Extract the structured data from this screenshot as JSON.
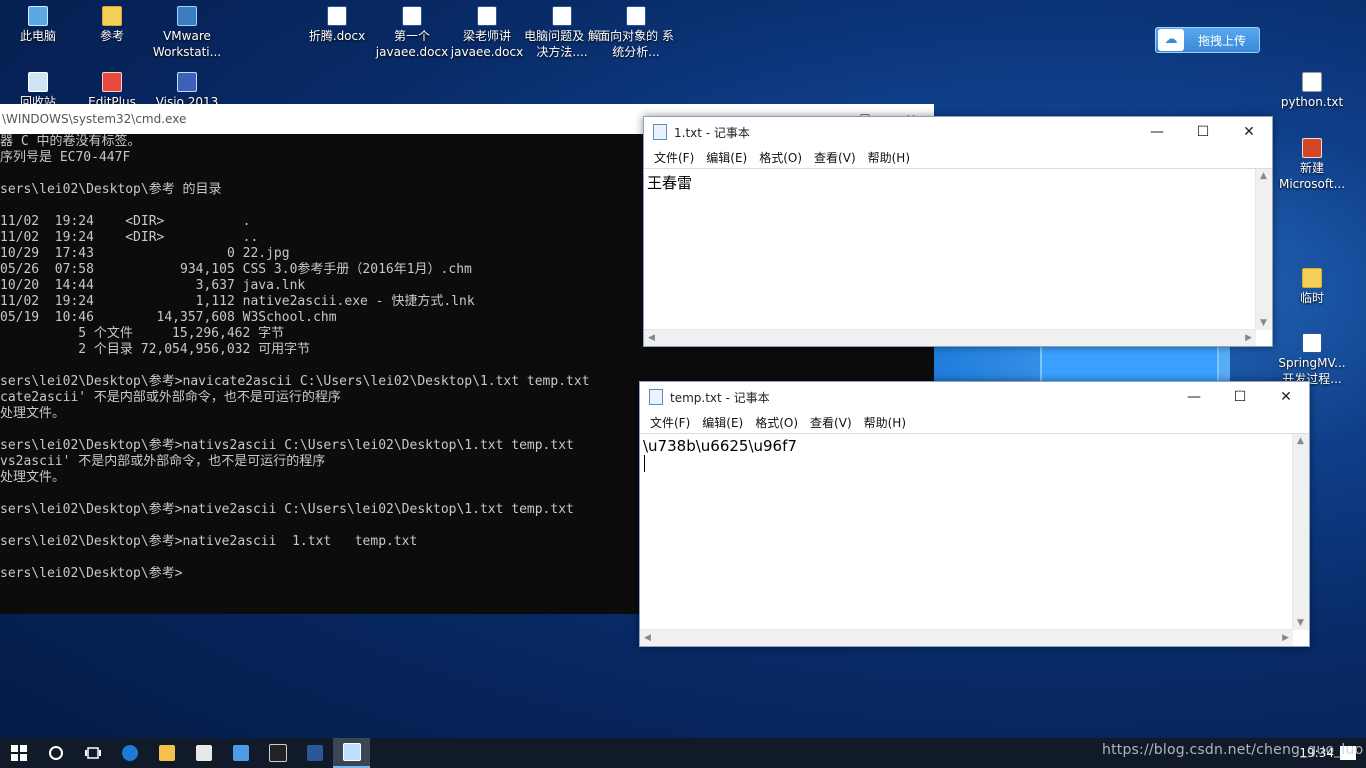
{
  "desktop": {
    "icons_top": [
      {
        "label": "此电脑",
        "icon": "pc-icon"
      },
      {
        "label": "参考",
        "icon": "folder-icon"
      },
      {
        "label": "VMware Workstati...",
        "icon": "vmware-icon"
      },
      {
        "label": "折腾.docx",
        "icon": "word-doc-icon"
      },
      {
        "label": "第一个 javaee.docx",
        "icon": "word-doc-icon"
      },
      {
        "label": "梁老师讲 javaee.docx",
        "icon": "word-doc-icon"
      },
      {
        "label": "电脑问题及 解决方法....",
        "icon": "word-doc-icon"
      },
      {
        "label": "面向对象的 系统分析...",
        "icon": "word-doc-icon"
      }
    ],
    "icons_row2": [
      {
        "label": "回收站",
        "icon": "recycle-bin-icon"
      },
      {
        "label": "EditPlus",
        "icon": "editplus-icon"
      },
      {
        "label": "Visio 2013",
        "icon": "visio-icon"
      }
    ],
    "icons_right": [
      {
        "label": "python.txt",
        "icon": "text-file-icon"
      },
      {
        "label": "新建 Microsoft...",
        "icon": "powerpoint-icon"
      },
      {
        "label": "临时",
        "icon": "folder-icon"
      },
      {
        "label": "SpringMV... 开发过程...",
        "icon": "word-doc-icon"
      }
    ],
    "upload_button": "拖拽上传"
  },
  "cmd": {
    "title": "\\WINDOWS\\system32\\cmd.exe",
    "lines": [
      "器 C 中的卷没有标签。",
      "序列号是 EC70-447F",
      "",
      "sers\\lei02\\Desktop\\参考 的目录",
      "",
      "11/02  19:24    <DIR>          .",
      "11/02  19:24    <DIR>          ..",
      "10/29  17:43                 0 22.jpg",
      "05/26  07:58           934,105 CSS 3.0参考手册（2016年1月）.chm",
      "10/20  14:44             3,637 java.lnk",
      "11/02  19:24             1,112 native2ascii.exe - 快捷方式.lnk",
      "05/19  10:46        14,357,608 W3School.chm",
      "          5 个文件     15,296,462 字节",
      "          2 个目录 72,054,956,032 可用字节",
      "",
      "sers\\lei02\\Desktop\\参考>navicate2ascii C:\\Users\\lei02\\Desktop\\1.txt temp.txt",
      "cate2ascii' 不是内部或外部命令，也不是可运行的程序",
      "处理文件。",
      "",
      "sers\\lei02\\Desktop\\参考>nativs2ascii C:\\Users\\lei02\\Desktop\\1.txt temp.txt",
      "vs2ascii' 不是内部或外部命令，也不是可运行的程序",
      "处理文件。",
      "",
      "sers\\lei02\\Desktop\\参考>native2ascii C:\\Users\\lei02\\Desktop\\1.txt temp.txt",
      "",
      "sers\\lei02\\Desktop\\参考>native2ascii  1.txt   temp.txt",
      "",
      "sers\\lei02\\Desktop\\参考>"
    ]
  },
  "notepad1": {
    "title": "1.txt - 记事本",
    "menu": [
      "文件(F)",
      "编辑(E)",
      "格式(O)",
      "查看(V)",
      "帮助(H)"
    ],
    "content": "王春雷"
  },
  "notepad2": {
    "title": "temp.txt - 记事本",
    "menu": [
      "文件(F)",
      "编辑(E)",
      "格式(O)",
      "查看(V)",
      "帮助(H)"
    ],
    "content": "\\u738b\\u6625\\u96f7"
  },
  "window_controls": {
    "minimize": "—",
    "maximize": "☐",
    "close": "✕"
  },
  "taskbar": {
    "clock": "19:34",
    "watermark": "https://blog.csdn.net/cheng_guo_luo"
  }
}
